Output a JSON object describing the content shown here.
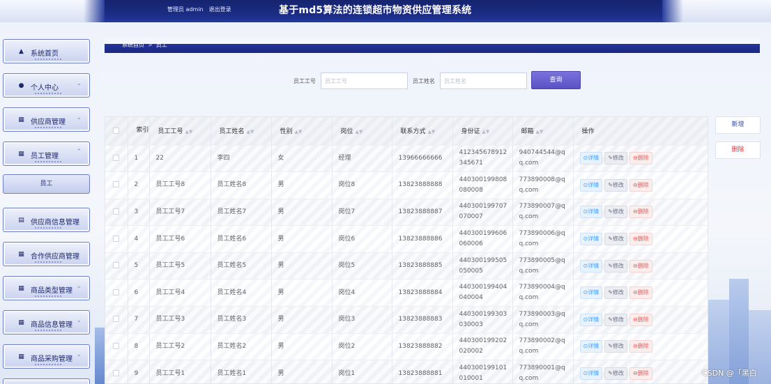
{
  "header": {
    "user_label": "管理员 admin",
    "logout_label": "退出登录",
    "title": "基于md5算法的连锁超市物资供应管理系统"
  },
  "sidebar": {
    "items": [
      {
        "label": "系统首页",
        "icon": "home-icon"
      },
      {
        "label": "个人中心",
        "icon": "user-icon"
      },
      {
        "label": "供应商管理",
        "icon": "grid-icon"
      },
      {
        "label": "员工管理",
        "icon": "grid-icon",
        "expanded": true
      },
      {
        "label": "供应商信息管理",
        "icon": "chart-icon"
      },
      {
        "label": "合作供应商管理",
        "icon": "grid-icon"
      },
      {
        "label": "商品类型管理",
        "icon": "grid-icon"
      },
      {
        "label": "商品信息管理",
        "icon": "grid-icon"
      },
      {
        "label": "商品采购管理",
        "icon": "grid-icon"
      }
    ],
    "submenu": {
      "label": "员工"
    }
  },
  "breadcrumb": {
    "home": "系统首页",
    "separator": ">",
    "current": "员工"
  },
  "search": {
    "employee_no_label": "员工工号",
    "employee_no_placeholder": "员工工号",
    "employee_no_value": "",
    "employee_name_label": "员工姓名",
    "employee_name_placeholder": "员工姓名",
    "employee_name_value": "",
    "button_label": "查询"
  },
  "actions": {
    "add_label": "新增",
    "delete_label": "删除"
  },
  "table": {
    "columns": [
      "索引",
      "员工工号",
      "员工姓名",
      "性别",
      "岗位",
      "联系方式",
      "身份证",
      "邮箱",
      "操作"
    ],
    "row_actions": {
      "detail": "⊙详情",
      "edit": "✎修改",
      "delete": "⊖删除"
    },
    "rows": [
      {
        "index": "1",
        "no": "22",
        "name": "李四",
        "gender": "女",
        "post": "经理",
        "phone": "13966666666",
        "id_card": "412345678912345671",
        "email": "940744544@qq.com"
      },
      {
        "index": "2",
        "no": "员工工号8",
        "name": "员工姓名8",
        "gender": "男",
        "post": "岗位8",
        "phone": "13823888888",
        "id_card": "440300199808080008",
        "email": "773890008@qq.com"
      },
      {
        "index": "3",
        "no": "员工工号7",
        "name": "员工姓名7",
        "gender": "男",
        "post": "岗位7",
        "phone": "13823888887",
        "id_card": "440300199707070007",
        "email": "773890007@qq.com"
      },
      {
        "index": "4",
        "no": "员工工号6",
        "name": "员工姓名6",
        "gender": "男",
        "post": "岗位6",
        "phone": "13823888886",
        "id_card": "440300199606060006",
        "email": "773890006@qq.com"
      },
      {
        "index": "5",
        "no": "员工工号5",
        "name": "员工姓名5",
        "gender": "男",
        "post": "岗位5",
        "phone": "13823888885",
        "id_card": "440300199505050005",
        "email": "773890005@qq.com"
      },
      {
        "index": "6",
        "no": "员工工号4",
        "name": "员工姓名4",
        "gender": "男",
        "post": "岗位4",
        "phone": "13823888884",
        "id_card": "440300199404040004",
        "email": "773890004@qq.com"
      },
      {
        "index": "7",
        "no": "员工工号3",
        "name": "员工姓名3",
        "gender": "男",
        "post": "岗位3",
        "phone": "13823888883",
        "id_card": "440300199303030003",
        "email": "773890003@qq.com"
      },
      {
        "index": "8",
        "no": "员工工号2",
        "name": "员工姓名2",
        "gender": "男",
        "post": "岗位2",
        "phone": "13823888882",
        "id_card": "440300199202020002",
        "email": "773890002@qq.com"
      },
      {
        "index": "9",
        "no": "员工工号1",
        "name": "员工姓名1",
        "gender": "男",
        "post": "岗位1",
        "phone": "13823888881",
        "id_card": "440300199101010001",
        "email": "773890001@qq.com"
      }
    ]
  },
  "watermark": "CSDN @「黑白"
}
